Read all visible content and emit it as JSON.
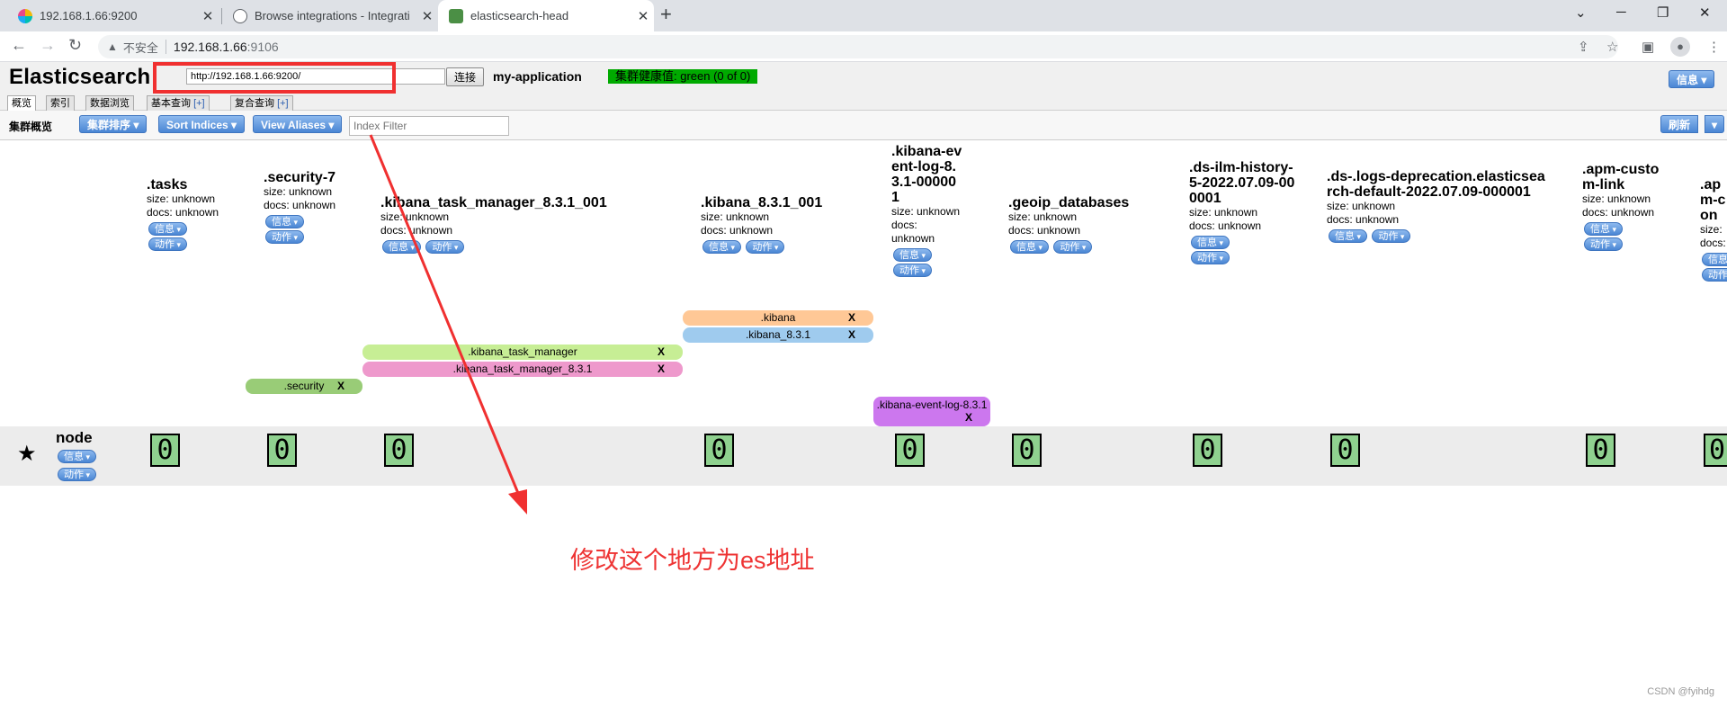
{
  "browser": {
    "tabs": [
      {
        "title": "192.168.1.66:9200"
      },
      {
        "title": "Browse integrations - Integrati"
      },
      {
        "title": "elasticsearch-head"
      }
    ],
    "address": {
      "security": "不安全",
      "host": "192.168.1.66",
      "port": ":9106"
    }
  },
  "app": {
    "logo": "Elasticsearch",
    "url_value": "http://192.168.1.66:9200/",
    "connect": "连接",
    "cluster_name": "my-application",
    "health": "集群健康值: green (0 of 0)",
    "info_button": "信息",
    "tabs": [
      {
        "label": "概览",
        "plus": ""
      },
      {
        "label": "索引",
        "plus": ""
      },
      {
        "label": "数据浏览",
        "plus": ""
      },
      {
        "label": "基本查询 ",
        "plus": "[+]"
      },
      {
        "label": "复合查询 ",
        "plus": "[+]"
      }
    ],
    "subbar": {
      "title": "集群概览",
      "sort_cluster": "集群排序",
      "sort_indices": "Sort Indices",
      "view_aliases": "View Aliases",
      "filter_placeholder": "Index Filter",
      "refresh": "刷新"
    }
  },
  "pill_labels": {
    "info": "信息",
    "action": "动作"
  },
  "indices": [
    {
      "name": ".tasks",
      "size": "size: unknown",
      "docs": "docs: unknown"
    },
    {
      "name": ".security-7",
      "size": "size: unknown",
      "docs": "docs: unknown"
    },
    {
      "name": ".kibana_task_manager_8.3.1_001",
      "size": "size: unknown",
      "docs": "docs: unknown"
    },
    {
      "name": ".kibana_8.3.1_001",
      "size": "size: unknown",
      "docs": "docs: unknown"
    },
    {
      "name": ".kibana-event-log-8.3.1-000001",
      "size": "size: unknown",
      "docs": "docs: unknown"
    },
    {
      "name": ".geoip_databases",
      "size": "size: unknown",
      "docs": "docs: unknown"
    },
    {
      "name": ".ds-ilm-history-5-2022.07.09-000001",
      "size": "size: unknown",
      "docs": "docs: unknown"
    },
    {
      "name": ".ds-.logs-deprecation.elasticsearch-default-2022.07.09-000001",
      "size": "size: unknown",
      "docs": "docs: unknown"
    },
    {
      "name": ".apm-custom-link",
      "size": "size: unknown",
      "docs": "docs: unknown"
    },
    {
      "name": ".apm-con",
      "size": "size:",
      "docs": "docs:"
    }
  ],
  "aliases": [
    {
      "name": ".kibana",
      "color": "#ffc896"
    },
    {
      "name": ".kibana_8.3.1",
      "color": "#9fcbee"
    },
    {
      "name": ".kibana_task_manager",
      "color": "#c7ee95"
    },
    {
      "name": ".kibana_task_manager_8.3.1",
      "color": "#ee99cc"
    },
    {
      "name": ".security",
      "color": "#99cc77"
    },
    {
      "name": ".kibana-event-log-8.3.1",
      "color": "#cc77ee"
    }
  ],
  "alias_close": "X",
  "node": {
    "name": "node",
    "shard_value": "0"
  },
  "annotation": "修改这个地方为es地址",
  "watermark": "CSDN @fyihdg"
}
